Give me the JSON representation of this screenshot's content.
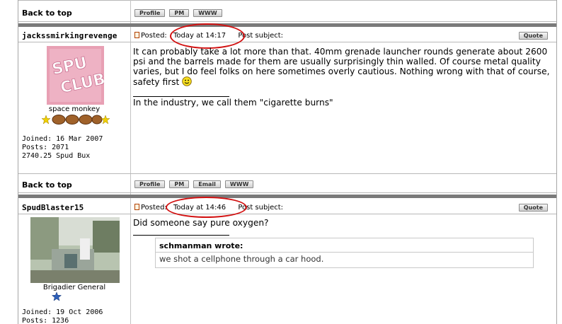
{
  "back_to_top": "Back to top",
  "buttons": {
    "profile": "Profile",
    "pm": "PM",
    "email": "Email",
    "www": "WWW",
    "quote": "Quote"
  },
  "posts": [
    {
      "author": "jackssmirkingrevenge",
      "posted_label": "Posted:",
      "time": "Today at 14:17",
      "subject_label": "Post subject:",
      "avatar_text": "SPUD CLUB",
      "rank": "space monkey",
      "joined": "Joined: 16 Mar 2007",
      "posts": "Posts: 2071",
      "bux": "2740.25 Spud Bux",
      "body": "It can probably take a lot more than that. 40mm grenade launcher rounds generate about 2600 psi and the barrels made for them are usually surprisingly thin walled. Of course metal quality varies, but I do feel folks on here sometimes overly cautious. Nothing wrong with that of course, safety first",
      "signature": "In the industry, we call them \"cigarette burns\""
    },
    {
      "author": "SpudBlaster15",
      "posted_label": "Posted:",
      "time": "Today at 14:46",
      "subject_label": "Post subject:",
      "rank": "Brigadier General",
      "joined": "Joined: 19 Oct 2006",
      "posts": "Posts: 1236",
      "body": "Did someone say pure oxygen?",
      "quote_author": "schmanman wrote:",
      "quote_text": "we shot a cellphone through a car hood."
    }
  ],
  "colors": {
    "highlight_circle": "#d21010",
    "separator": "#7a7a7a",
    "avatar_pink": "#e8a0b4",
    "star_gold": "#f0d000",
    "star_blue": "#2d5fb8"
  }
}
